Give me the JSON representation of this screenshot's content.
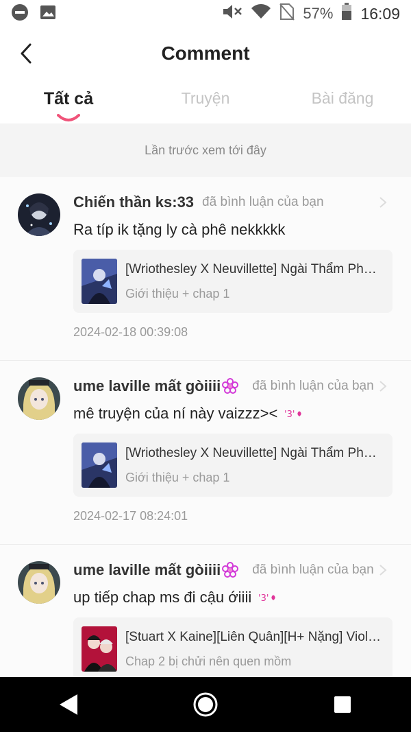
{
  "status_bar": {
    "battery": "57%",
    "time": "16:09"
  },
  "header": {
    "title": "Comment"
  },
  "tabs": [
    {
      "label": "Tất cả",
      "active": true
    },
    {
      "label": "Truyện",
      "active": false
    },
    {
      "label": "Bài đăng",
      "active": false
    }
  ],
  "last_seen": "Lần trước xem tới đây",
  "comments": [
    {
      "username": "Chiến thần ks:33",
      "action": "đã bình luận của bạn",
      "text": "Ra típ ik tặng ly cà phê nekkkkk",
      "story_title": "[Wriothesley X Neuvillette] Ngài Thẩm Phán...",
      "story_sub": "Giới thiệu + chap 1",
      "timestamp": "2024-02-18 00:39:08"
    },
    {
      "username": "ume laville mất gòiiii",
      "action": "đã bình luận của bạn",
      "text": "mê truyện của ní này vaizzz><",
      "story_title": "[Wriothesley X Neuvillette] Ngài Thẩm Phán...",
      "story_sub": "Giới thiệu + chap 1",
      "timestamp": "2024-02-17 08:24:01"
    },
    {
      "username": "ume laville mất gòiiii",
      "action": "đã bình luận của bạn",
      "text": "up tiếp chap ms đi cậu ớiiii",
      "story_title": "[Stuart X Kaine][Liên Quân][H+ Nặng] Violet...",
      "story_sub": "Chap 2 bị chửi nên quen mồm",
      "timestamp": ""
    }
  ],
  "colors": {
    "accent": "#f0547a",
    "kaomoji": "#e0359a"
  }
}
